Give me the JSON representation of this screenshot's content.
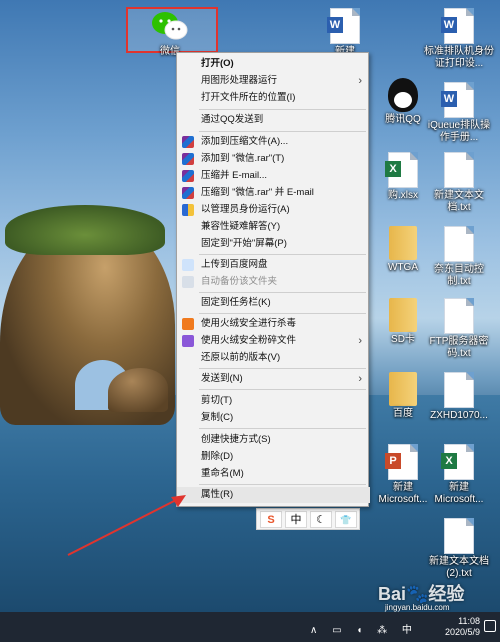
{
  "desktop": {
    "icons": [
      {
        "label": "微信",
        "type": "wechat"
      },
      {
        "label": "新建",
        "type": "word"
      },
      {
        "label": "标准排队机身份证打印设...",
        "type": "word"
      },
      {
        "label": "腾讯QQ",
        "type": "qq"
      },
      {
        "label": "iQueue排队操作手册...",
        "type": "word"
      },
      {
        "label": "购.xlsx",
        "type": "excel"
      },
      {
        "label": "新建文本文档.txt",
        "type": "txt"
      },
      {
        "label": "WTGA",
        "type": "folder"
      },
      {
        "label": "奈东目动控制.txt",
        "type": "txt"
      },
      {
        "label": "SD卡",
        "type": "folder"
      },
      {
        "label": "FTP服务器密码.txt",
        "type": "txt"
      },
      {
        "label": "百度",
        "type": "folder"
      },
      {
        "label": "ZXHD1070...",
        "type": "txt"
      },
      {
        "label": "新建 Microsoft...",
        "type": "ppt"
      },
      {
        "label": "新建 Microsoft...",
        "type": "excel"
      },
      {
        "label": "新建文本文档(2).txt",
        "type": "txt"
      }
    ]
  },
  "context_menu": {
    "items": [
      {
        "label": "打开(O)",
        "bold": true
      },
      {
        "label": "用图形处理器运行",
        "submenu": true
      },
      {
        "label": "打开文件所在的位置(I)"
      },
      {
        "label": "通过QQ发送到"
      },
      {
        "label": "添加到压缩文件(A)...",
        "icon": "rar"
      },
      {
        "label": "添加到 \"微信.rar\"(T)",
        "icon": "rar"
      },
      {
        "label": "压缩并 E-mail...",
        "icon": "rar"
      },
      {
        "label": "压缩到 \"微信.rar\" 并 E-mail",
        "icon": "rar"
      },
      {
        "label": "以管理员身份运行(A)",
        "icon": "shield"
      },
      {
        "label": "兼容性疑难解答(Y)"
      },
      {
        "label": "固定到\"开始\"屏幕(P)"
      },
      {
        "label": "上传到百度网盘",
        "icon": "cloud"
      },
      {
        "label": "自动备份该文件夹",
        "icon": "cloud2",
        "disabled": true
      },
      {
        "label": "固定到任务栏(K)"
      },
      {
        "label": "使用火绒安全进行杀毒",
        "icon": "fire"
      },
      {
        "label": "使用火绒安全粉碎文件",
        "icon": "purple",
        "submenu": true
      },
      {
        "label": "还原以前的版本(V)"
      },
      {
        "label": "发送到(N)",
        "submenu": true
      },
      {
        "label": "剪切(T)"
      },
      {
        "label": "复制(C)"
      },
      {
        "label": "创建快捷方式(S)"
      },
      {
        "label": "删除(D)"
      },
      {
        "label": "重命名(M)"
      },
      {
        "label": "属性(R)",
        "highlight": true
      }
    ]
  },
  "ime_toolbar": {
    "items": [
      "S",
      "中",
      "☾",
      "👕"
    ]
  },
  "taskbar": {
    "time": "11:08",
    "date": "2020/5/9",
    "tray_icons": "∧ ▭ ◖ ⁂ 中"
  },
  "watermark": {
    "logo": "Bai🐾经验",
    "sub": "jingyan.baidu.com"
  },
  "colors": {
    "highlight_red": "#e0342e",
    "menu_bg": "#f2f2f2",
    "taskbar_bg": "#1f2733"
  }
}
